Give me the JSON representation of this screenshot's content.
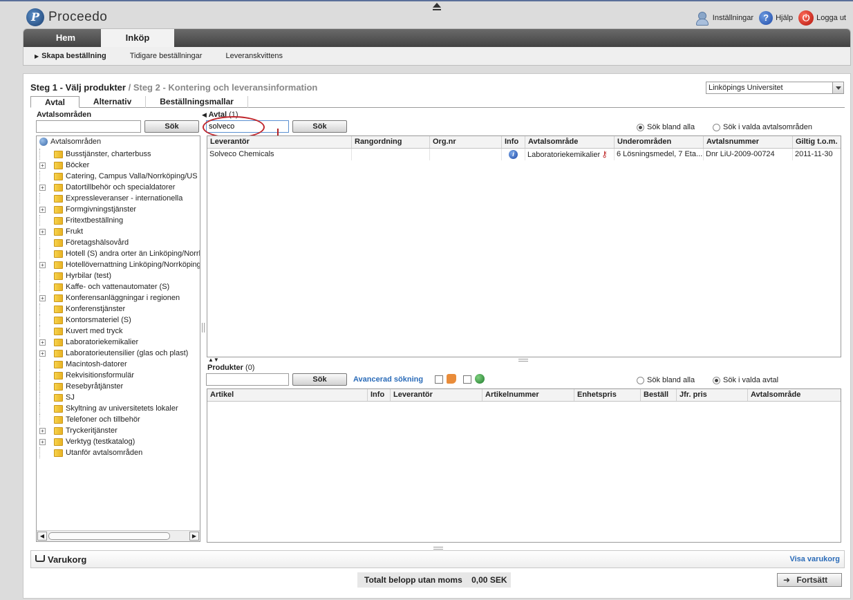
{
  "app": {
    "title": "Proceedo"
  },
  "toplinks": {
    "settings": "Inställningar",
    "help": "Hjälp",
    "logout": "Logga ut"
  },
  "nav": {
    "tabs": [
      "Hem",
      "Inköp"
    ],
    "active_tab": "Inköp",
    "subnav": [
      "Skapa beställning",
      "Tidigare beställningar",
      "Leveranskvittens"
    ]
  },
  "steps": {
    "step1": "Steg 1 - Välj produkter",
    "separator": " / ",
    "step2": "Steg 2 - Kontering och leveransinformation"
  },
  "org_select": {
    "value": "Linköpings Universitet"
  },
  "panel_tabs": [
    "Avtal",
    "Alternativ",
    "Beställningsmallar"
  ],
  "left": {
    "label": "Avtalsområden",
    "search_button": "Sök",
    "search_value": "",
    "tree_root": "Avtalsområden",
    "tree_items": [
      {
        "label": "Busstjänster, charterbuss",
        "expandable": false
      },
      {
        "label": "Böcker",
        "expandable": true
      },
      {
        "label": "Catering, Campus Valla/Norrköping/US",
        "expandable": false
      },
      {
        "label": "Datortillbehör och specialdatorer",
        "expandable": true
      },
      {
        "label": "Expressleveranser - internationella",
        "expandable": false
      },
      {
        "label": "Formgivningstjänster",
        "expandable": true
      },
      {
        "label": "Fritextbeställning",
        "expandable": false
      },
      {
        "label": "Frukt",
        "expandable": true
      },
      {
        "label": "Företagshälsovård",
        "expandable": false
      },
      {
        "label": "Hotell (S) andra orter än Linköping/Norrk",
        "expandable": false
      },
      {
        "label": "Hotellövernattning Linköping/Norrköping",
        "expandable": true
      },
      {
        "label": "Hyrbilar (test)",
        "expandable": false
      },
      {
        "label": "Kaffe- och vattenautomater (S)",
        "expandable": false
      },
      {
        "label": "Konferensanläggningar i regionen",
        "expandable": true
      },
      {
        "label": "Konferenstjänster",
        "expandable": false
      },
      {
        "label": "Kontorsmateriel (S)",
        "expandable": false
      },
      {
        "label": "Kuvert med tryck",
        "expandable": false
      },
      {
        "label": "Laboratoriekemikalier",
        "expandable": true
      },
      {
        "label": "Laboratorieutensilier (glas och plast)",
        "expandable": true
      },
      {
        "label": "Macintosh-datorer",
        "expandable": false
      },
      {
        "label": "Rekvisitionsformulär",
        "expandable": false
      },
      {
        "label": "Resebyråtjänster",
        "expandable": false
      },
      {
        "label": "SJ",
        "expandable": false
      },
      {
        "label": "Skyltning av universitetets lokaler",
        "expandable": false
      },
      {
        "label": "Telefoner och tillbehör",
        "expandable": false
      },
      {
        "label": "Tryckeritjänster",
        "expandable": true
      },
      {
        "label": "Verktyg (testkatalog)",
        "expandable": true
      },
      {
        "label": "Utanför avtalsområden",
        "expandable": false
      }
    ]
  },
  "avtal": {
    "label": "Avtal",
    "count": "(1)",
    "search_value": "solveco",
    "search_button": "Sök",
    "radio_all": "Sök bland alla",
    "radio_selected": "Sök i valda avtalsområden",
    "radio_checked": "all",
    "columns": [
      "Leverantör",
      "Rangordning",
      "Org.nr",
      "Info",
      "Avtalsområde",
      "Underområden",
      "Avtalsnummer",
      "Giltig t.o.m."
    ],
    "rows": [
      {
        "leverantor": "Solveco Chemicals",
        "rangordning": "",
        "orgnr": "",
        "info": "i",
        "avtalsomrade": "Laboratoriekemikalier",
        "underomraden": "6 Lösningsmedel, 7 Eta...",
        "avtalsnummer": "Dnr LiU-2009-00724",
        "giltig": "2011-11-30"
      }
    ]
  },
  "produkter": {
    "label": "Produkter",
    "count": "(0)",
    "search_value": "",
    "search_button": "Sök",
    "advanced": "Avancerad sökning",
    "radio_all": "Sök bland alla",
    "radio_selected": "Sök i valda avtal",
    "radio_checked": "selected",
    "columns": [
      "Artikel",
      "Info",
      "Leverantör",
      "Artikelnummer",
      "Enhetspris",
      "Beställ",
      "Jfr. pris",
      "Avtalsområde"
    ]
  },
  "cart": {
    "title": "Varukorg",
    "link": "Visa varukorg"
  },
  "total": {
    "label": "Totalt belopp utan moms",
    "value": "0,00 SEK"
  },
  "continue_button": "Fortsätt"
}
